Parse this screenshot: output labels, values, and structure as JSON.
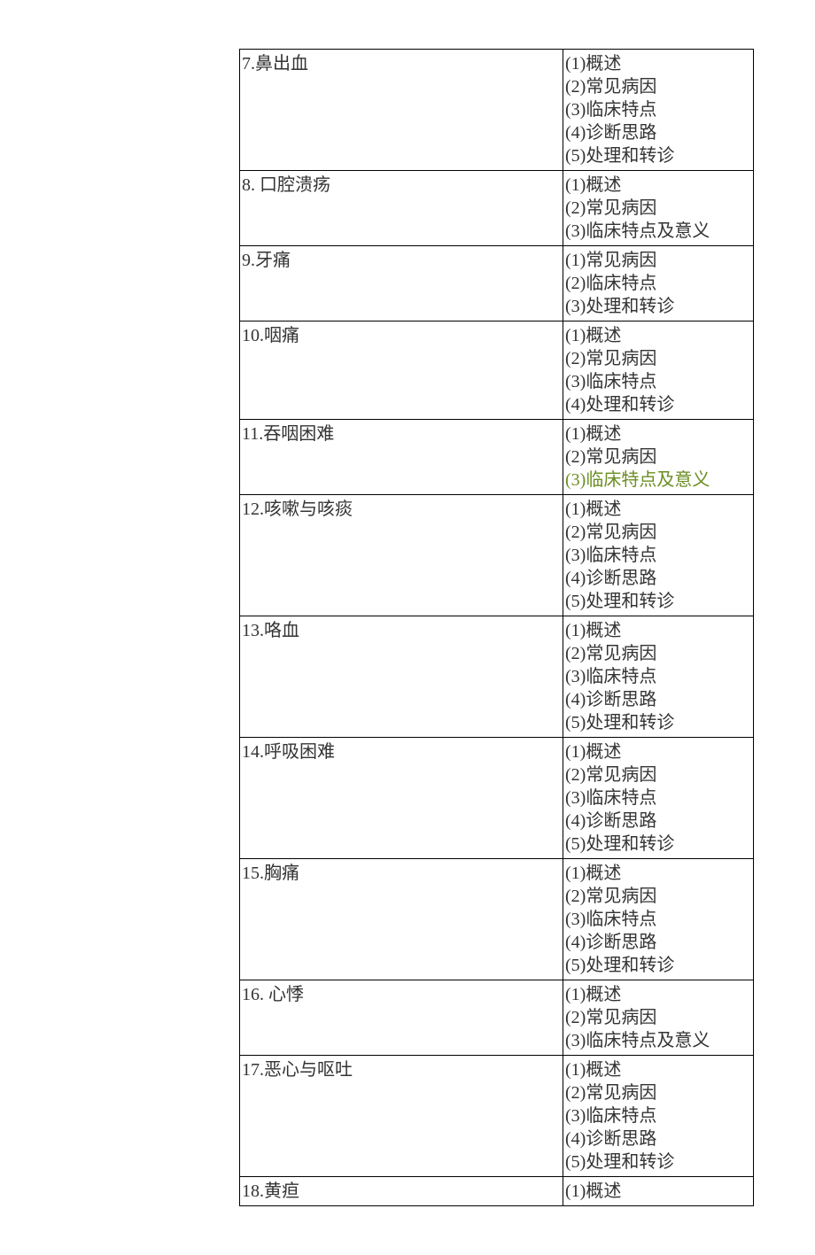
{
  "rows": [
    {
      "topic": "7.鼻出血",
      "points": [
        "(1)概述",
        "(2)常见病因",
        "(3)临床特点",
        "(4)诊断思路",
        "(5)处理和转诊"
      ]
    },
    {
      "topic": "8. 口腔溃疡",
      "points": [
        "(1)概述",
        "(2)常见病因",
        "(3)临床特点及意义"
      ]
    },
    {
      "topic": "9.牙痛",
      "points": [
        "(1)常见病因",
        "(2)临床特点",
        "(3)处理和转诊"
      ]
    },
    {
      "topic": "10.咽痛",
      "points": [
        "(1)概述",
        "(2)常见病因",
        "(3)临床特点",
        "(4)处理和转诊"
      ]
    },
    {
      "topic": "11.吞咽困难",
      "points": [
        "(1)概述",
        "(2)常见病因",
        {
          "t": "(3)临床特点及意义",
          "hl": true
        }
      ]
    },
    {
      "topic": "12.咳嗽与咳痰",
      "points": [
        "(1)概述",
        "(2)常见病因",
        "(3)临床特点",
        "(4)诊断思路",
        "(5)处理和转诊"
      ]
    },
    {
      "topic": "13.咯血",
      "points": [
        "(1)概述",
        "(2)常见病因",
        "(3)临床特点",
        "(4)诊断思路",
        "(5)处理和转诊"
      ]
    },
    {
      "topic": "14.呼吸困难",
      "points": [
        "(1)概述",
        "(2)常见病因",
        "(3)临床特点",
        "(4)诊断思路",
        "(5)处理和转诊"
      ]
    },
    {
      "topic": "15.胸痛",
      "points": [
        "(1)概述",
        "(2)常见病因",
        "(3)临床特点",
        "(4)诊断思路",
        "(5)处理和转诊"
      ]
    },
    {
      "topic": "16. 心悸",
      "points": [
        "(1)概述",
        "(2)常见病因",
        "(3)临床特点及意义"
      ]
    },
    {
      "topic": "17.恶心与呕吐",
      "points": [
        "(1)概述",
        "(2)常见病因",
        "(3)临床特点",
        "(4)诊断思路",
        "(5)处理和转诊"
      ]
    },
    {
      "topic": "18.黄疸",
      "points": [
        "(1)概述"
      ]
    }
  ]
}
